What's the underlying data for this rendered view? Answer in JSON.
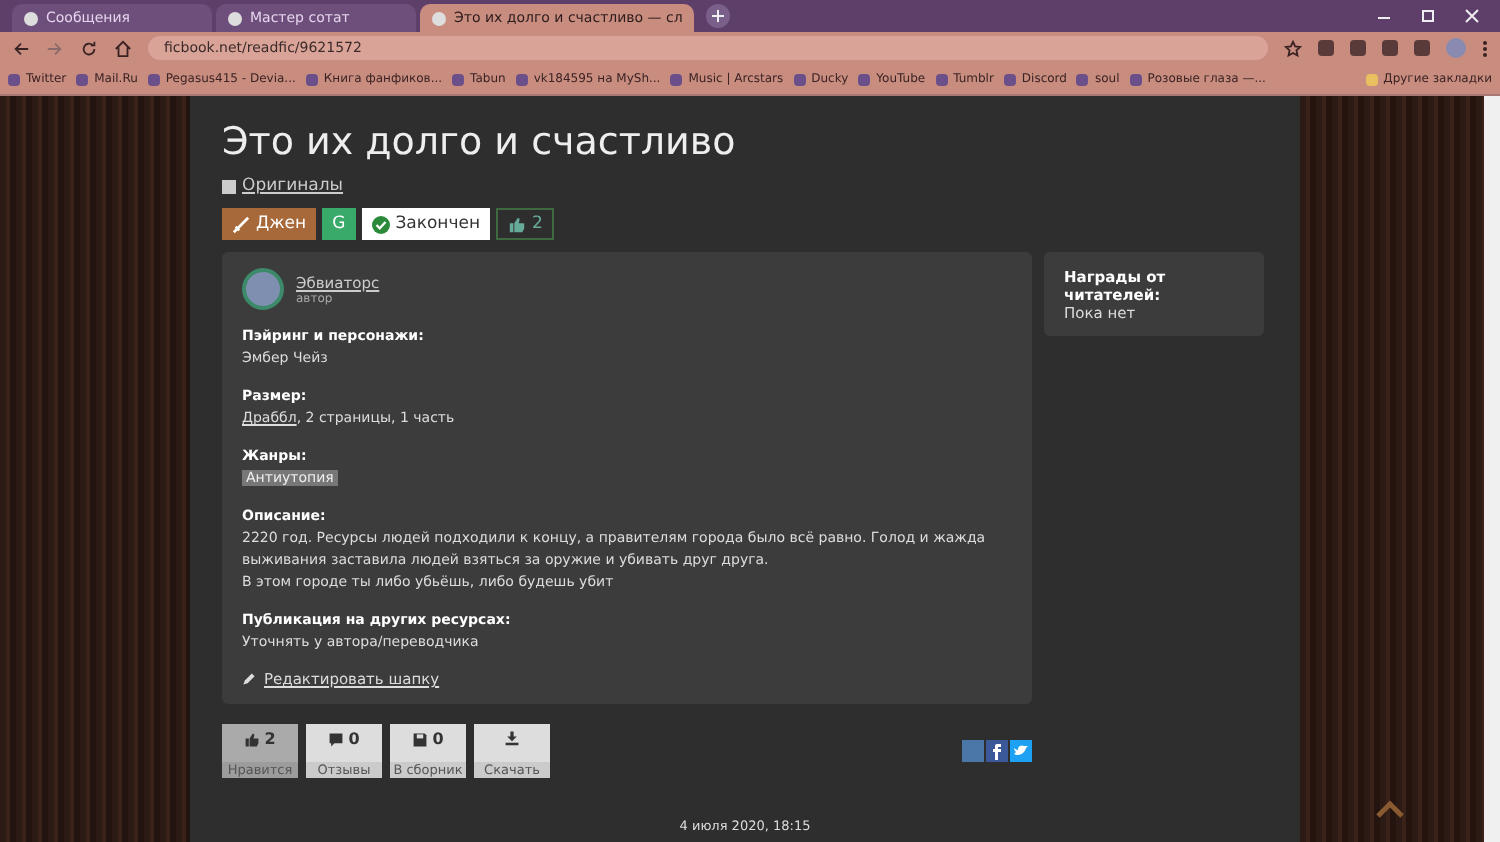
{
  "browser": {
    "tabs": [
      {
        "title": "Сообщения",
        "selected": false
      },
      {
        "title": "Мастер сотат",
        "selected": false
      },
      {
        "title": "Это их долго и счастливо — сл",
        "selected": true
      }
    ],
    "url": "ficbook.net/readfic/9621572",
    "bookmarks": [
      "Twitter",
      "Mail.Ru",
      "Pegasus415 - Devia...",
      "Книга фанфиков...",
      "Tabun",
      "vk184595 на MySh...",
      "Music | Arcstars",
      "Ducky",
      "YouTube",
      "Tumblr",
      "Discord",
      "soul",
      "Розовые глаза —..."
    ],
    "other_bookmarks": "Другие закладки"
  },
  "fic": {
    "title": "Это их долго и счастливо",
    "fandom": "Оригиналы",
    "badges": [
      {
        "kind": "direction",
        "label": "Джен"
      },
      {
        "kind": "rating",
        "label": "G"
      },
      {
        "kind": "status",
        "label": "Закончен"
      },
      {
        "kind": "likes",
        "label": "2"
      }
    ],
    "author": {
      "name": "Эбвиаторс",
      "role": "автор"
    },
    "sections": [
      {
        "heading": "Пэйринг и персонажи:",
        "kind": "text",
        "text": "Эмбер Чейз"
      },
      {
        "heading": "Размер:",
        "kind": "size",
        "link": "Драббл",
        "text": ", 2 страницы, 1 часть"
      },
      {
        "heading": "Жанры:",
        "kind": "tags",
        "tags": [
          "Антиутопия"
        ]
      },
      {
        "heading": "Описание:",
        "kind": "text",
        "text": "2220 год. Ресурсы людей подходили к концу, а правителям города было всё равно. Голод и жажда выживания заставила людей взяться за оружие и убивать друг друга.\nВ этом городе ты либо убьёшь, либо будешь убит"
      },
      {
        "heading": "Публикация на других ресурсах:",
        "kind": "text",
        "text": "Уточнять у автора/переводчика"
      }
    ],
    "edit_link": "Редактировать шапку",
    "actions": [
      {
        "kind": "like",
        "count": "2",
        "label": "Нравится"
      },
      {
        "kind": "reviews",
        "count": "0",
        "label": "Отзывы"
      },
      {
        "kind": "collections",
        "count": "0",
        "label": "В сборник"
      },
      {
        "kind": "download",
        "label": "Скачать"
      }
    ],
    "date": "4 июля 2020, 18:15"
  },
  "awards": {
    "heading": "Награды от читателей:",
    "text": "Пока нет"
  }
}
